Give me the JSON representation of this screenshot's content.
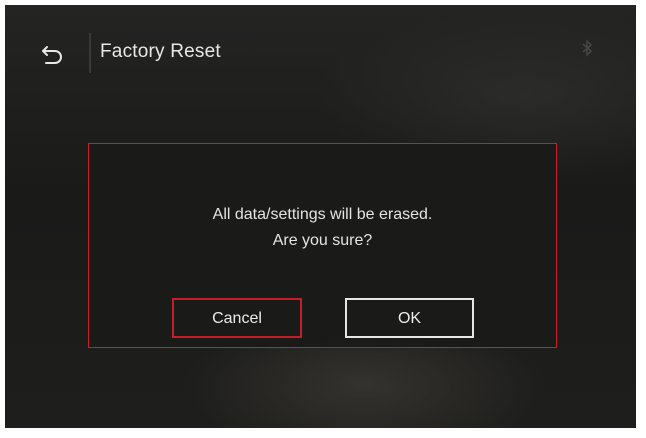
{
  "header": {
    "title": "Factory Reset",
    "back_icon": "back-arrow-icon",
    "status_icon": "bluetooth-icon"
  },
  "dialog": {
    "message_line1": "All data/settings will be erased.",
    "message_line2": "Are you sure?",
    "cancel_label": "Cancel",
    "ok_label": "OK",
    "focused_button": "cancel"
  },
  "colors": {
    "background": "#1c1c1b",
    "accent_red": "#c8202c",
    "text": "#e8e8e4",
    "ok_border": "#e6e6e3"
  }
}
